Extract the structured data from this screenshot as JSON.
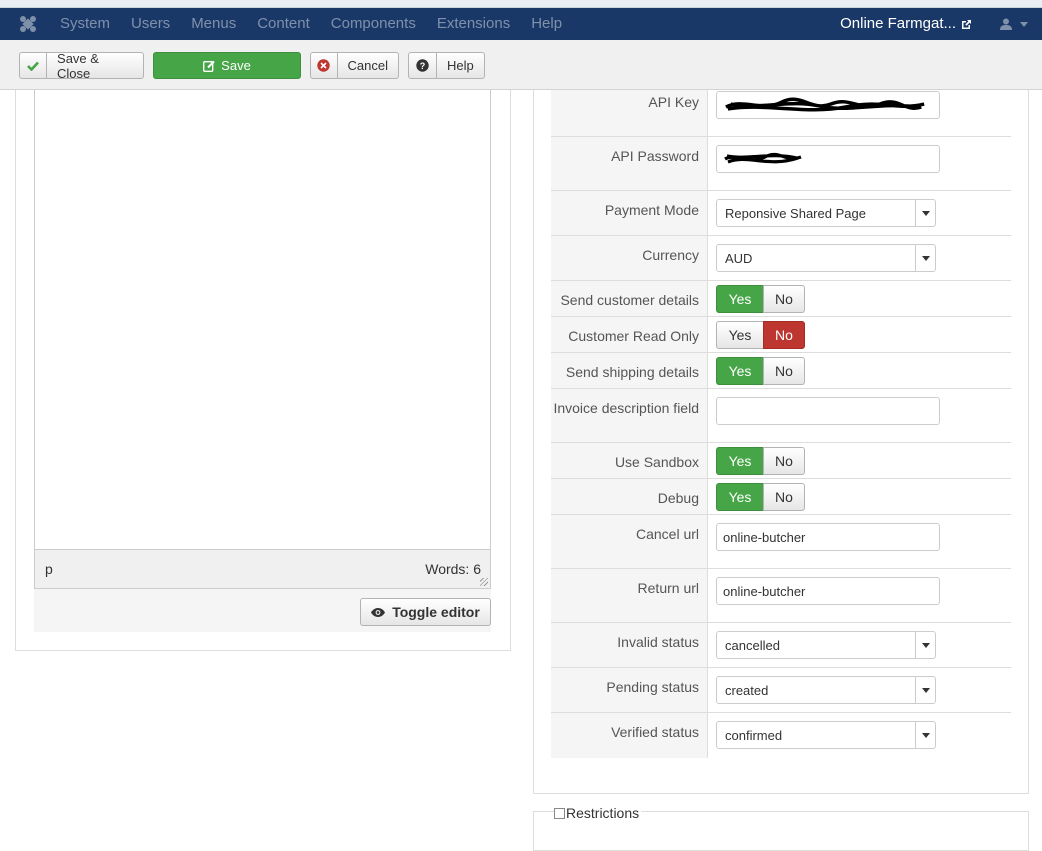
{
  "navbar": {
    "menu": [
      "System",
      "Users",
      "Menus",
      "Content",
      "Components",
      "Extensions",
      "Help"
    ],
    "site_name": "Online Farmgat..."
  },
  "toolbar": {
    "save_close": "Save & Close",
    "save": "Save",
    "cancel": "Cancel",
    "help": "Help"
  },
  "editor": {
    "path": "p",
    "words": "Words: 6",
    "toggle": "Toggle editor"
  },
  "form": {
    "api_key": {
      "label": "API Key",
      "value": ""
    },
    "api_password": {
      "label": "API Password",
      "value": ""
    },
    "payment_mode": {
      "label": "Payment Mode",
      "value": "Reponsive Shared Page"
    },
    "currency": {
      "label": "Currency",
      "value": "AUD"
    },
    "send_customer_details": {
      "label": "Send customer details",
      "value": "Yes"
    },
    "customer_read_only": {
      "label": "Customer Read Only",
      "value": "No"
    },
    "send_shipping_details": {
      "label": "Send shipping details",
      "value": "Yes"
    },
    "invoice_description": {
      "label": "Invoice description field",
      "value": ""
    },
    "use_sandbox": {
      "label": "Use Sandbox",
      "value": "Yes"
    },
    "debug": {
      "label": "Debug",
      "value": "Yes"
    },
    "cancel_url": {
      "label": "Cancel url",
      "value": "online-butcher"
    },
    "return_url": {
      "label": "Return url",
      "value": "online-butcher"
    },
    "invalid_status": {
      "label": "Invalid status",
      "value": "cancelled"
    },
    "pending_status": {
      "label": "Pending status",
      "value": "created"
    },
    "verified_status": {
      "label": "Verified status",
      "value": "confirmed"
    },
    "yes_label": "Yes",
    "no_label": "No"
  },
  "restrictions": {
    "label": "Restrictions"
  },
  "colors": {
    "navbar": "#1a3867",
    "success": "#46a546",
    "danger": "#bd362f"
  }
}
